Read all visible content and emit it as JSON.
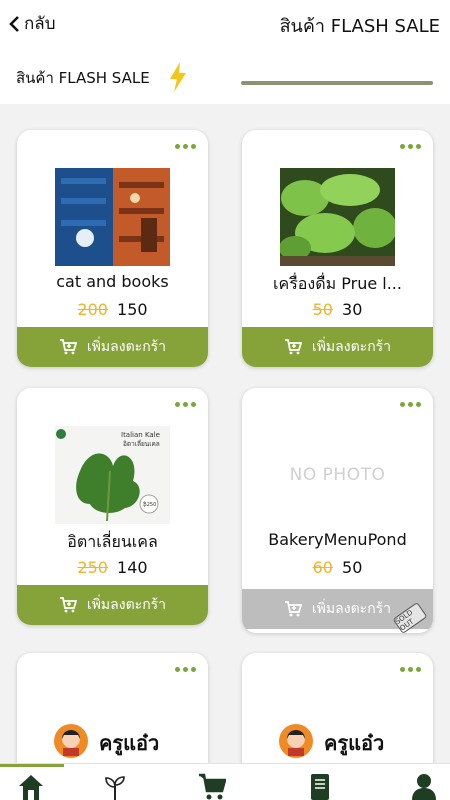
{
  "header": {
    "back_label": "กลับ",
    "title": "สินค้า FLASH SALE"
  },
  "section": {
    "title": "สินค้า FLASH SALE"
  },
  "products": [
    {
      "name": "cat and books",
      "old_price": "200",
      "price": "150",
      "cart_label": "เพิ่มลงตะกร้า",
      "image": "cat-and-books-photo"
    },
    {
      "name": "เครื่องดื่ม Prue l...",
      "old_price": "50",
      "price": "30",
      "cart_label": "เพิ่มลงตะกร้า",
      "image": "green-vegetable-photo"
    },
    {
      "name": "อิตาเลี่ยนเคล",
      "old_price": "250",
      "price": "140",
      "cart_label": "เพิ่มลงตะกร้า",
      "image": "italian-kale-photo",
      "image_text": {
        "title": "Italian Kale",
        "subtitle": "อิตาเลี่ยนเคล",
        "tag": "₿250"
      }
    },
    {
      "name": "BakeryMenuPond",
      "old_price": "60",
      "price": "50",
      "cart_label": "เพิ่มลงตะกร้า",
      "image": "no-photo-placeholder",
      "placeholder_text": "NO PHOTO",
      "badge": "SOLD OUT",
      "sold_out": true
    },
    {
      "logo": "ครูแอ๋ว",
      "image": "kru-aew-logo"
    },
    {
      "logo": "ครูแอ๋ว",
      "image": "kru-aew-logo"
    }
  ],
  "bottom_nav": [
    {
      "icon": "home-icon",
      "active": true
    },
    {
      "icon": "sprout-icon"
    },
    {
      "icon": "cart-icon"
    },
    {
      "icon": "receipt-icon"
    },
    {
      "icon": "user-icon"
    }
  ],
  "colors": {
    "accent": "#86a33a",
    "old_price": "#f0b429",
    "dots": "#7da63a",
    "disabled": "#bdbdbd"
  }
}
